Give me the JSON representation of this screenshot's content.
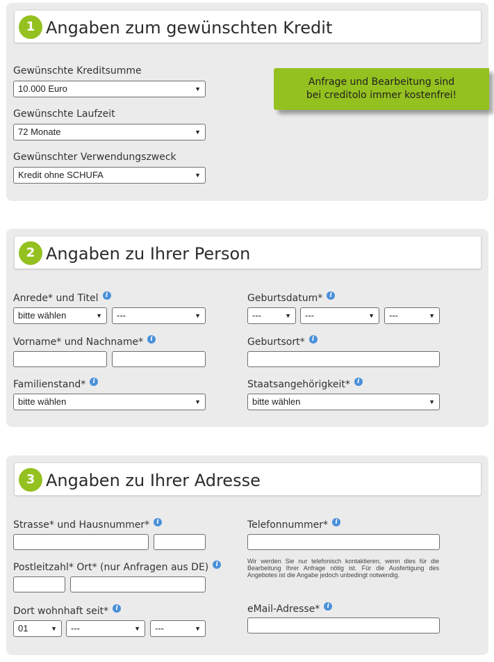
{
  "section1": {
    "number": "1",
    "title": "Angaben zum gewünschten Kredit",
    "kreditsumme_label": "Gewünschte Kreditsumme",
    "kreditsumme_value": "10.000 Euro",
    "laufzeit_label": "Gewünschte Laufzeit",
    "laufzeit_value": "72 Monate",
    "zweck_label": "Gewünschter Verwendungszweck",
    "zweck_value": "Kredit ohne SCHUFA",
    "cta_line1": "Anfrage und Bearbeitung sind",
    "cta_line2": "bei creditolo immer kostenfrei!"
  },
  "section2": {
    "number": "2",
    "title": "Angaben zu Ihrer Person",
    "anrede_label": "Anrede* und Titel",
    "anrede_value": "bitte wählen",
    "titel_value": "---",
    "geburtsdatum_label": "Geburtsdatum*",
    "geb_day": "---",
    "geb_month": "---",
    "geb_year": "---",
    "name_label": "Vorname* und Nachname*",
    "geburtsort_label": "Geburtsort*",
    "familienstand_label": "Familienstand*",
    "familienstand_value": "bitte wählen",
    "staatsangehoerigkeit_label": "Staatsangehörigkeit*",
    "staatsangehoerigkeit_value": "bitte wählen"
  },
  "section3": {
    "number": "3",
    "title": "Angaben zu Ihrer Adresse",
    "strasse_label": "Strasse* und Hausnummer*",
    "telefon_label": "Telefonnummer*",
    "plz_label": "Postleitzahl* Ort* (nur Anfragen aus DE)",
    "telefon_note": "Wir werden Sie nur telefonisch kontaktieren, wenn dies für die Bearbeitung Ihrer Anfrage nötig ist. Für die Ausfertigung des Angebotes ist die Angabe jedoch unbedingt notwendig.",
    "wohnhaft_label": "Dort wohnhaft seit*",
    "wohnhaft_month": "01",
    "wohnhaft_year": "---",
    "wohnhaft_extra": "---",
    "email_label": "eMail-Adresse*"
  },
  "icons": {
    "info": "info-icon",
    "dropdown": "chevron-down-icon"
  },
  "colors": {
    "accent": "#94c11f",
    "panel": "#ebebeb",
    "info": "#4a90d9"
  }
}
